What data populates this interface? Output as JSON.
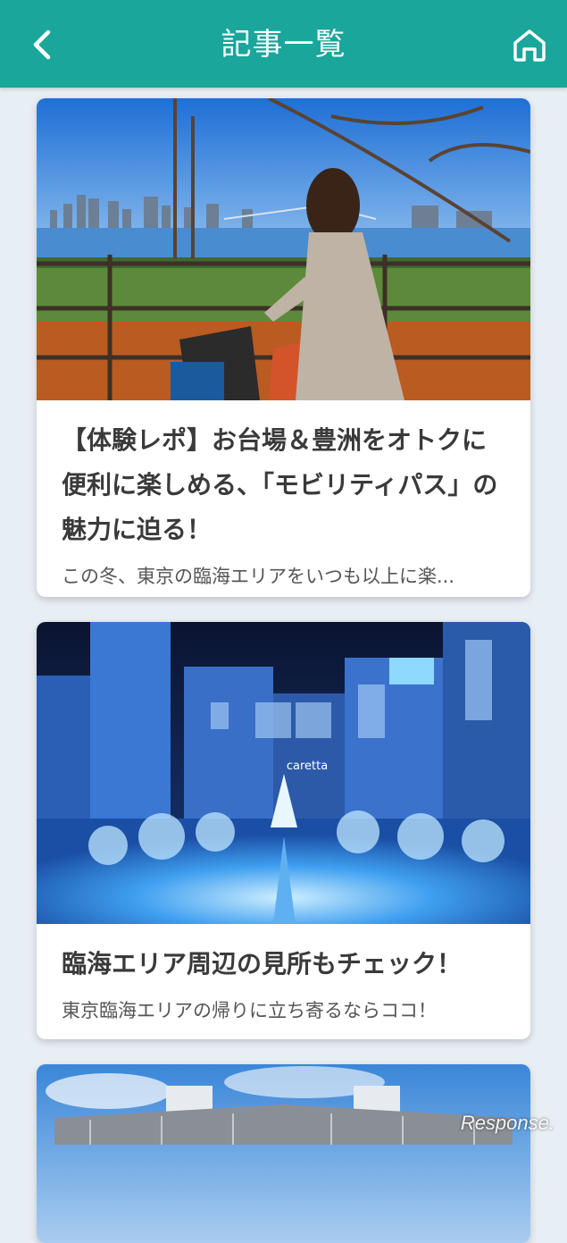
{
  "header": {
    "title": "記事一覧",
    "back_icon": "chevron-left-icon",
    "home_icon": "home-icon",
    "background_color": "#1aa69b"
  },
  "articles": [
    {
      "title": "【体験レポ】お台場＆豊洲をオトクに便利に楽しめる、「モビリティパス」の魅力に迫る！",
      "description": "この冬、東京の臨海エリアをいつも以上に楽..."
    },
    {
      "title": "臨海エリア周辺の見所もチェック！",
      "description": "東京臨海エリアの帰りに立ち寄るならココ！",
      "photo_sign_text": "caretta"
    },
    {
      "title": "",
      "description": ""
    }
  ],
  "watermark": "Response."
}
